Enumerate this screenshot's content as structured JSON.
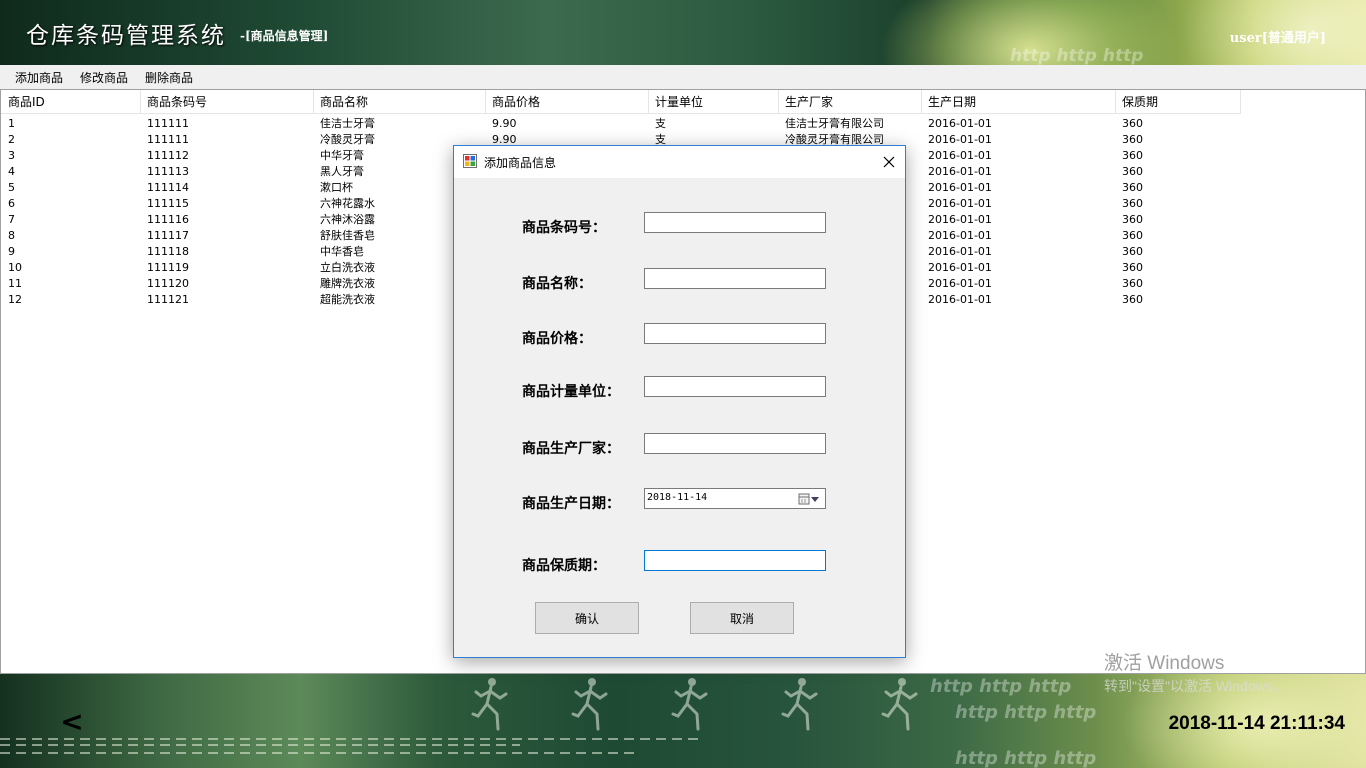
{
  "header": {
    "app_title": "仓库条码管理系统",
    "module_name": "-[商品信息管理]",
    "user_info": "user[普通用户]",
    "watermark": "http http http"
  },
  "menu": {
    "items": [
      {
        "label": "添加商品"
      },
      {
        "label": "修改商品"
      },
      {
        "label": "删除商品"
      }
    ]
  },
  "grid": {
    "columns": [
      "商品ID",
      "商品条码号",
      "商品名称",
      "商品价格",
      "计量单位",
      "生产厂家",
      "生产日期",
      "保质期"
    ],
    "rows": [
      [
        "1",
        "111111",
        "佳洁士牙膏",
        "9.90",
        "支",
        "佳洁士牙膏有限公司",
        "2016-01-01",
        "360"
      ],
      [
        "2",
        "111111",
        "冷酸灵牙膏",
        "9.90",
        "支",
        "冷酸灵牙膏有限公司",
        "2016-01-01",
        "360"
      ],
      [
        "3",
        "111112",
        "中华牙膏",
        "",
        "",
        "",
        "2016-01-01",
        "360"
      ],
      [
        "4",
        "111113",
        "黑人牙膏",
        "",
        "",
        "",
        "2016-01-01",
        "360"
      ],
      [
        "5",
        "111114",
        "漱口杯",
        "",
        "",
        "",
        "2016-01-01",
        "360"
      ],
      [
        "6",
        "111115",
        "六神花露水",
        "",
        "",
        "",
        "2016-01-01",
        "360"
      ],
      [
        "7",
        "111116",
        "六神沐浴露",
        "",
        "",
        "",
        "2016-01-01",
        "360"
      ],
      [
        "8",
        "111117",
        "舒肤佳香皂",
        "",
        "",
        "",
        "2016-01-01",
        "360"
      ],
      [
        "9",
        "111118",
        "中华香皂",
        "",
        "",
        "",
        "2016-01-01",
        "360"
      ],
      [
        "10",
        "111119",
        "立白洗衣液",
        "",
        "",
        "",
        "2016-01-01",
        "360"
      ],
      [
        "11",
        "111120",
        "雕牌洗衣液",
        "",
        "",
        "",
        "2016-01-01",
        "360"
      ],
      [
        "12",
        "111121",
        "超能洗衣液",
        "",
        "",
        "",
        "2016-01-01",
        "360"
      ]
    ]
  },
  "dialog": {
    "title": "添加商品信息",
    "fields": {
      "barcode": {
        "label": "商品条码号：",
        "value": ""
      },
      "name": {
        "label": "商品名称：",
        "value": ""
      },
      "price": {
        "label": "商品价格：",
        "value": ""
      },
      "unit": {
        "label": "商品计量单位：",
        "value": ""
      },
      "manufacturer": {
        "label": "商品生产厂家：",
        "value": ""
      },
      "production_date": {
        "label": "商品生产日期：",
        "value": "2018-11-14"
      },
      "shelf_life": {
        "label": "商品保质期：",
        "value": ""
      }
    },
    "confirm_label": "确认",
    "cancel_label": "取消"
  },
  "footer": {
    "back_label": "<",
    "clock": "2018-11-14 21:11:34",
    "activate_title": "激活 Windows",
    "activate_sub": "转到\"设置\"以激活 Windows。"
  },
  "colors": {
    "dialog_border": "#2f7fcf",
    "focus_border": "#0078d7",
    "menu_bg": "#f0f0f0"
  },
  "icons": {
    "dialog": "form-icon",
    "close": "close-icon",
    "calendar": "calendar-icon",
    "runner": "runner-icon"
  }
}
